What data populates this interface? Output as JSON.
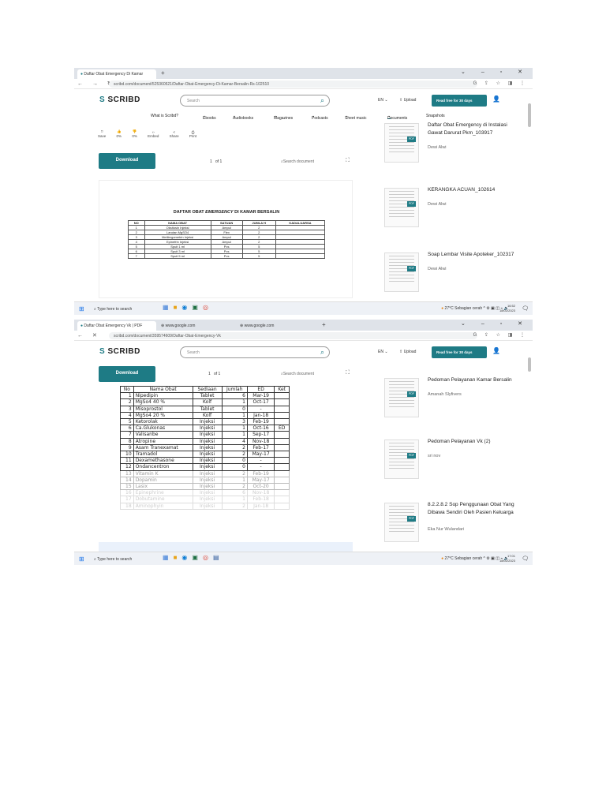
{
  "screens": [
    {
      "tabs": [
        {
          "label": "Daftar Obat Emergency Di Kamar"
        }
      ],
      "url": "scribd.com/document/525360521/Daftar-Obat-Emergency-Di-Kamar-Bersalin-Rs-102510",
      "search_placeholder": "Search",
      "lang": "EN",
      "upload": "Upload",
      "read_free": "Read free for 30 days",
      "nav": [
        "What is Scribd?",
        "Ebooks",
        "Audiobooks",
        "Magazines",
        "Podcasts",
        "Sheet music",
        "Documents",
        "Snapshots"
      ],
      "actions": [
        {
          "icon": "bookmark-icon",
          "glyph": "⌑",
          "label": "Save"
        },
        {
          "icon": "thumbs-up-icon",
          "glyph": "👍",
          "label": "0%"
        },
        {
          "icon": "thumbs-down-icon",
          "glyph": "👎",
          "label": "0%"
        },
        {
          "icon": "embed-icon",
          "glyph": "‹›",
          "label": "Embed"
        },
        {
          "icon": "share-icon",
          "glyph": "<",
          "label": "Share"
        },
        {
          "icon": "print-icon",
          "glyph": "⎙",
          "label": "Print"
        }
      ],
      "download": "Download",
      "page_current": "1",
      "page_total": "of 1",
      "doc_search": "Search document",
      "doc_title_pre": "DAFTAR OBAT ",
      "doc_title_em": "EMERGENCY",
      "doc_title_post": " DI KAMAR BERSALIN",
      "doc_headers": [
        "NO",
        "NAMA OBAT",
        "SATUAN",
        "JUMLA H",
        "KADALUARSA"
      ],
      "doc_rows": [
        [
          "1",
          "Oksitosin Injeksi",
          "Ampul",
          "2",
          ""
        ],
        [
          "2",
          "Larutan MgSO4",
          "Flex",
          "2",
          ""
        ],
        [
          "3",
          "Metilergometrin Injeksi",
          "Ampul",
          "2",
          ""
        ],
        [
          "4",
          "Epinefrin Injeksi",
          "Ampul",
          "2",
          ""
        ],
        [
          "5",
          "Spuit 1 ml",
          "Pcs",
          "5",
          ""
        ],
        [
          "6",
          "Spuit 3 ml",
          "Pcs",
          "5",
          ""
        ],
        [
          "7",
          "Spuit 5 ml",
          "Pcs",
          "5",
          ""
        ]
      ],
      "sidebar": [
        {
          "title": "Daftar Obat Emergency di Instalasi Gawat Darurat Pkm_103917",
          "author": "Dewi Alwi"
        },
        {
          "title": "KERANGKA ACUAN_102614",
          "author": "Dewi Alwi"
        },
        {
          "title": "Soap Lembar Visite Apoteker_102317",
          "author": "Dewi Alwi"
        }
      ],
      "taskbar": {
        "search": "Type here to search",
        "weather": "27°C Sebagian cerah",
        "time": "16:52",
        "date": "18/02/2023"
      }
    },
    {
      "tabs": [
        {
          "label": "Daftar Obat Emergency Vk | PDF"
        },
        {
          "label": "www.google.com"
        },
        {
          "label": "www.google.com"
        }
      ],
      "url": "scribd.com/document/359574609/Daftar-Obat-Emergency-Vk",
      "search_placeholder": "Search",
      "lang": "EN",
      "upload": "Upload",
      "read_free": "Read free for 30 days",
      "download": "Download",
      "page_current": "1",
      "page_total": "of 1",
      "doc_search": "Search document",
      "doc_headers": [
        "No",
        "Nama Obat",
        "Sediaan",
        "Jumlah",
        "ED",
        "Ket"
      ],
      "doc_rows": [
        [
          "1",
          "Nipedipin",
          "Tablet",
          "6",
          "Mar-19",
          ""
        ],
        [
          "2",
          "MgSo4 40 %",
          "Kolf",
          "1",
          "Oct-17",
          ""
        ],
        [
          "3",
          "Misoprostol",
          "Tablet",
          "0",
          "-",
          ""
        ],
        [
          "4",
          "MgSo4 20 %",
          "Kolf",
          "1",
          "Jan-18",
          ""
        ],
        [
          "5",
          "Ketorolak",
          "Injeksi",
          "3",
          "Feb-19",
          ""
        ],
        [
          "6",
          "Ca.Glukonas",
          "Injeksi",
          "1",
          "Oct-16",
          "ED"
        ],
        [
          "7",
          "Valisanbe",
          "Injeksi",
          "1",
          "Sep-17",
          ""
        ],
        [
          "8",
          "Atropine",
          "Injeksi",
          "4",
          "Nov-18",
          ""
        ],
        [
          "9",
          "Asam Tranexamat",
          "Injeksi",
          "2",
          "Feb-17",
          ""
        ],
        [
          "10",
          "Tramadol",
          "Injeksi",
          "2",
          "May-17",
          ""
        ],
        [
          "11",
          "Dexamethasone",
          "Injeksi",
          "0",
          "-",
          ""
        ],
        [
          "12",
          "Ondancentron",
          "Injeksi",
          "0",
          "-",
          ""
        ],
        [
          "13",
          "Vitamin K",
          "Injeksi",
          "2",
          "Feb-19",
          ""
        ],
        [
          "14",
          "Dopamin",
          "Injeksi",
          "1",
          "May-17",
          ""
        ],
        [
          "15",
          "Lasix",
          "Injeksi",
          "2",
          "Oct-20",
          ""
        ],
        [
          "16",
          "Epinephrine",
          "Injeksi",
          "6",
          "Nov-18",
          ""
        ],
        [
          "17",
          "Dobutamine",
          "Injeksi",
          "1",
          "Feb-18",
          ""
        ],
        [
          "18",
          "Aminophyin",
          "Injeksi",
          "2",
          "Jan-18",
          ""
        ]
      ],
      "sidebar": [
        {
          "title": "Pedoman Pelayanan Kamar Bersalin",
          "author": "Amanah Slyfivers"
        },
        {
          "title": "Pedoman Pelayanan Vk (2)",
          "author": "sri nov"
        },
        {
          "title": "8.2.2.8.2 Sop Penggunaan Obat Yang Dibawa Sendiri Oleh Pasien Keluarga",
          "author": "Eka Nur Wulandari"
        }
      ],
      "taskbar": {
        "search": "Type here to search",
        "weather": "27°C Sebagian cerah",
        "time": "17:01",
        "date": "18/02/2023"
      }
    }
  ],
  "colors": {
    "accent": "#1e7b85",
    "taskbar": "#eef1f6",
    "tabbar": "#dfe3e9"
  }
}
